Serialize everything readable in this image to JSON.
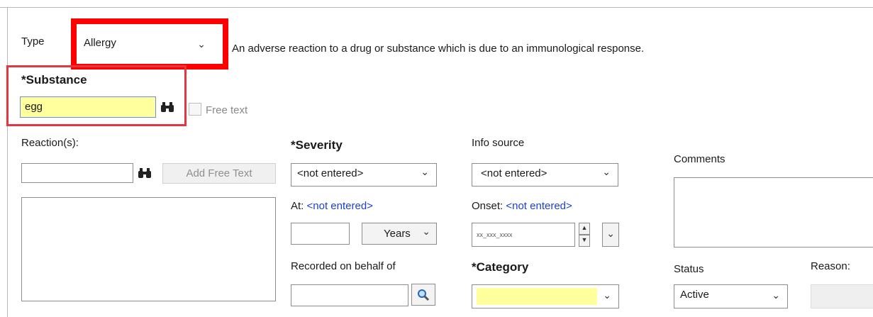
{
  "type": {
    "label": "Type",
    "value": "Allergy",
    "description": "An adverse reaction to a drug or substance which is due to an immunological response."
  },
  "substance": {
    "label": "*Substance",
    "value": "egg",
    "free_text_label": "Free text"
  },
  "reactions": {
    "label": "Reaction(s):",
    "input_value": "",
    "add_free_text_label": "Add Free Text"
  },
  "severity": {
    "label": "*Severity",
    "value": "<not entered>",
    "at_label": "At:",
    "at_link": "<not entered>",
    "years_value": "Years",
    "number_value": ""
  },
  "info_source": {
    "label": "Info source",
    "value": "<not entered>",
    "onset_label": "Onset:",
    "onset_link": "<not entered>",
    "date_placeholder": "xx_xxx_xxxx"
  },
  "recorded": {
    "label": "Recorded on behalf of",
    "value": ""
  },
  "category": {
    "label": "*Category",
    "value": ""
  },
  "comments": {
    "label": "Comments",
    "value": ""
  },
  "status": {
    "label": "Status",
    "value": "Active"
  },
  "reason": {
    "label": "Reason:"
  },
  "icons": {
    "binoculars": "binoculars-icon",
    "magnifier": "magnifier-icon",
    "chevron": "chevron-down-icon"
  },
  "colors": {
    "highlight_yellow": "#ffff9e",
    "annotation_red": "#ff0000",
    "link_blue": "#1a3fd8"
  }
}
